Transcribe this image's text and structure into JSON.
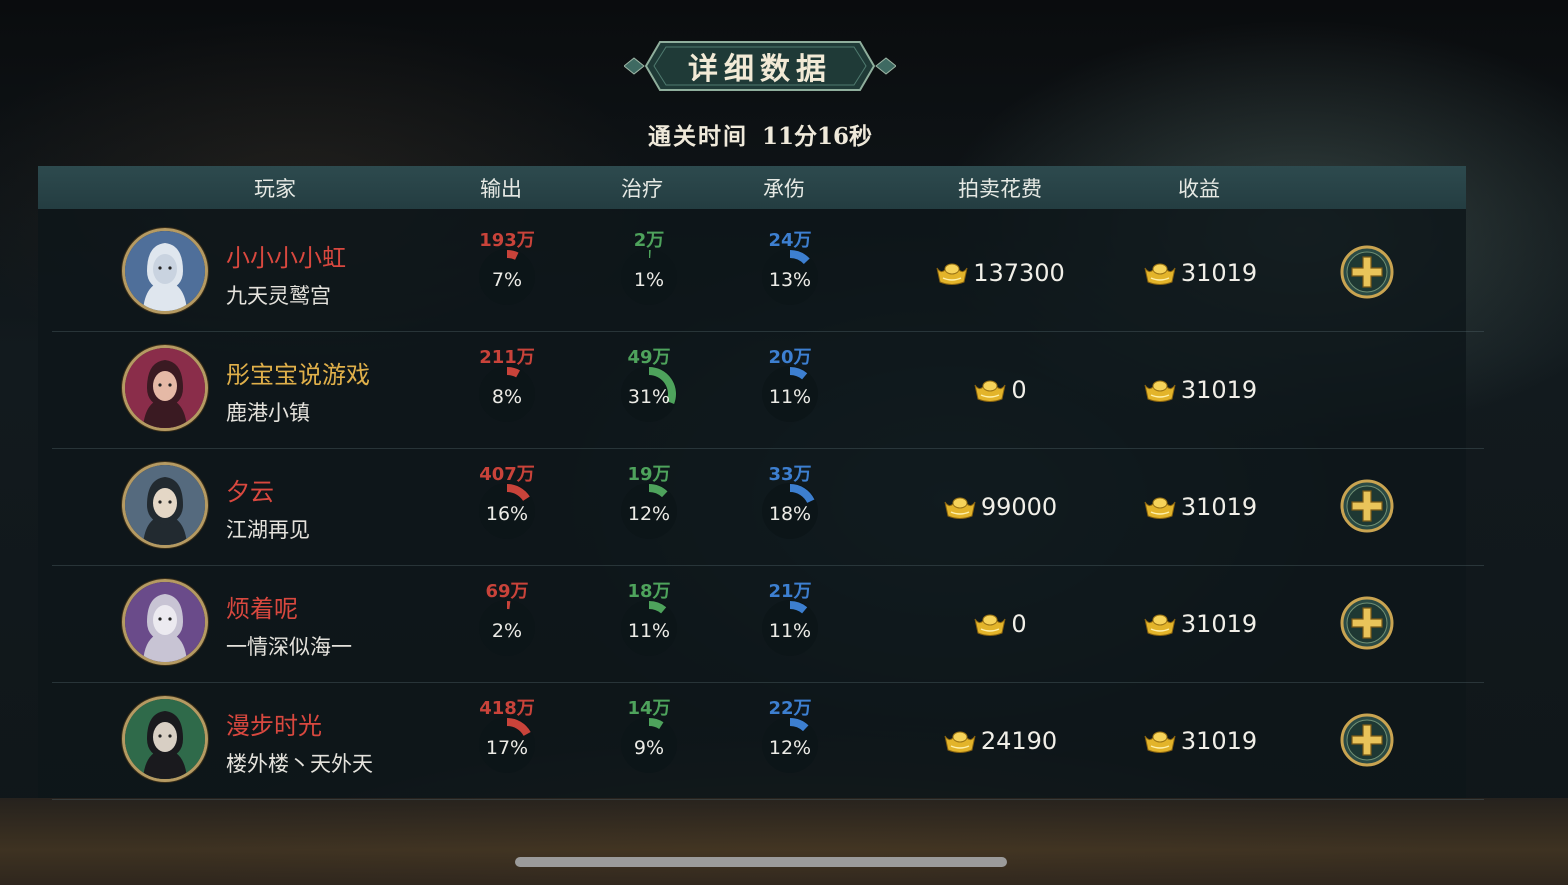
{
  "title": "详细数据",
  "clear_time": {
    "label": "通关时间",
    "value": "11分16秒"
  },
  "headers": {
    "player": "玩家",
    "output": "输出",
    "heal": "治疗",
    "taken": "承伤",
    "auction_cost": "拍卖花费",
    "income": "收益"
  },
  "colors": {
    "output": "#c9433a",
    "heal": "#4ea35c",
    "taken": "#3d7fd0",
    "name_red": "#d9483f",
    "name_gold": "#e0b04a"
  },
  "icons": {
    "currency": "gold-ingot-icon",
    "add": "plus-icon"
  },
  "players": [
    {
      "name": "小小小小虹",
      "name_color": "#d9483f",
      "guild": "九天灵鹫宫",
      "output": {
        "value": "193万",
        "pct": "7%",
        "ratio": 0.07
      },
      "heal": {
        "value": "2万",
        "pct": "1%",
        "ratio": 0.01
      },
      "taken": {
        "value": "24万",
        "pct": "13%",
        "ratio": 0.13
      },
      "auction_cost": "137300",
      "income": "31019",
      "has_add": true
    },
    {
      "name": "彤宝宝说游戏",
      "name_color": "#e0b04a",
      "guild": "鹿港小镇",
      "output": {
        "value": "211万",
        "pct": "8%",
        "ratio": 0.08
      },
      "heal": {
        "value": "49万",
        "pct": "31%",
        "ratio": 0.31
      },
      "taken": {
        "value": "20万",
        "pct": "11%",
        "ratio": 0.11
      },
      "auction_cost": "0",
      "income": "31019",
      "has_add": false
    },
    {
      "name": "夕云",
      "name_color": "#d9483f",
      "guild": "江湖再见",
      "output": {
        "value": "407万",
        "pct": "16%",
        "ratio": 0.16
      },
      "heal": {
        "value": "19万",
        "pct": "12%",
        "ratio": 0.12
      },
      "taken": {
        "value": "33万",
        "pct": "18%",
        "ratio": 0.18
      },
      "auction_cost": "99000",
      "income": "31019",
      "has_add": true
    },
    {
      "name": "烦着呢",
      "name_color": "#d9483f",
      "guild": "一情深似海一",
      "output": {
        "value": "69万",
        "pct": "2%",
        "ratio": 0.02
      },
      "heal": {
        "value": "18万",
        "pct": "11%",
        "ratio": 0.11
      },
      "taken": {
        "value": "21万",
        "pct": "11%",
        "ratio": 0.11
      },
      "auction_cost": "0",
      "income": "31019",
      "has_add": true
    },
    {
      "name": "漫步时光",
      "name_color": "#d9483f",
      "guild": "楼外楼丶天外天",
      "output": {
        "value": "418万",
        "pct": "17%",
        "ratio": 0.17
      },
      "heal": {
        "value": "14万",
        "pct": "9%",
        "ratio": 0.09
      },
      "taken": {
        "value": "22万",
        "pct": "12%",
        "ratio": 0.12
      },
      "auction_cost": "24190",
      "income": "31019",
      "has_add": true
    }
  ]
}
